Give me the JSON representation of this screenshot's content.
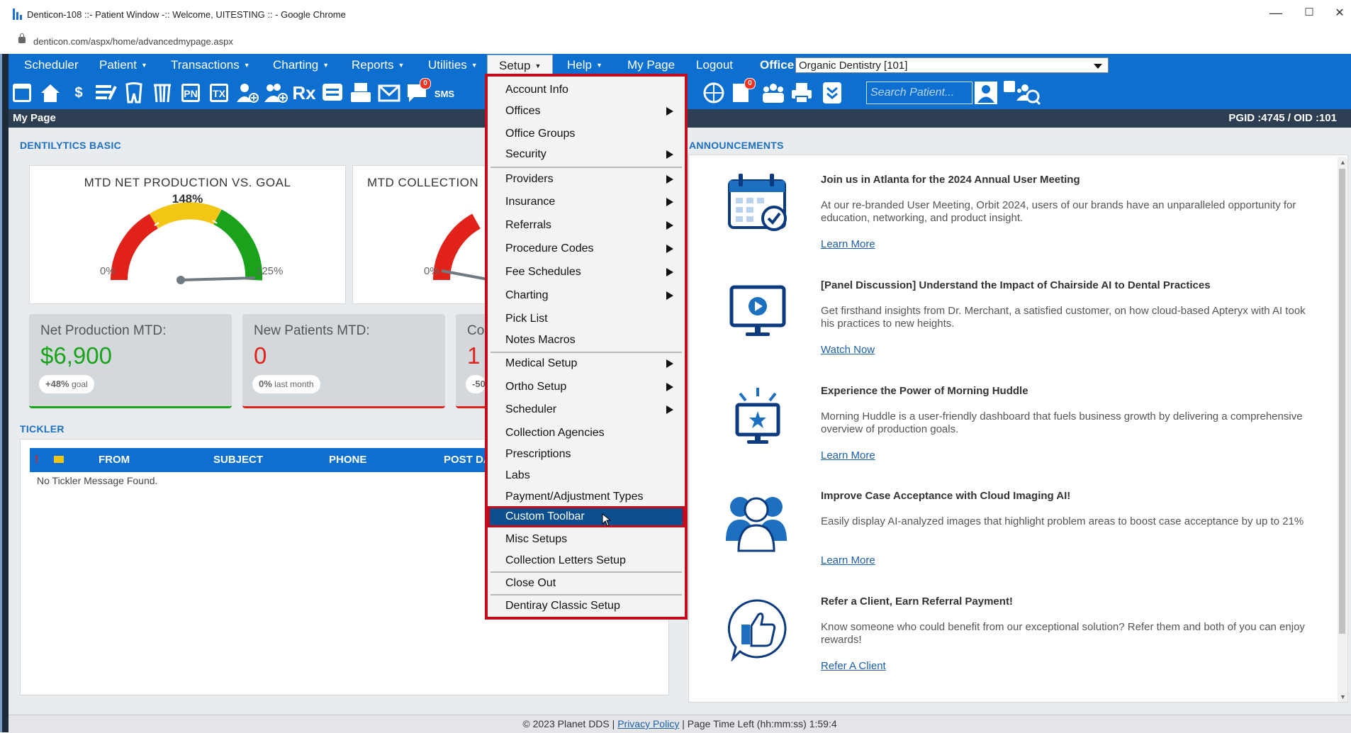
{
  "browser": {
    "title": "Denticon-108 ::- Patient Window -:: Welcome, UITESTING :: - Google Chrome",
    "url": "denticon.com/aspx/home/advancedmypage.aspx",
    "controls": {
      "minimize": "—",
      "maximize": "☐",
      "close": "✕"
    }
  },
  "nav": {
    "items": [
      {
        "label": "Scheduler"
      },
      {
        "label": "Patient",
        "caret": "▼"
      },
      {
        "label": "Transactions",
        "caret": "▼"
      },
      {
        "label": "Charting",
        "caret": "▼"
      },
      {
        "label": "Reports",
        "caret": "▼"
      },
      {
        "label": "Utilities",
        "caret": "▼"
      },
      {
        "label": "Setup",
        "caret": "▼",
        "active": true
      },
      {
        "label": "Help",
        "caret": "▼"
      },
      {
        "label": "My Page"
      },
      {
        "label": "Logout"
      }
    ],
    "office_label": "Office",
    "office_value": "Organic Dentistry [101]"
  },
  "toolbar": {
    "text_icons": {
      "pn": "PN",
      "tx": "TX",
      "rx": "Rx",
      "sms": "SMS"
    },
    "badge": "0",
    "search_placeholder": "Search Patient..."
  },
  "section": {
    "title": "My Page",
    "ids": "PGID :4745  /  OID :101"
  },
  "dentilytics": {
    "heading": "DENTILYTICS BASIC",
    "gauge1": {
      "title": "MTD NET PRODUCTION VS. GOAL",
      "percent": "148%",
      "min": "0%",
      "max": "125%"
    },
    "gauge2": {
      "title": "MTD COLLECTION",
      "min": "0%"
    },
    "stats": [
      {
        "label": "Net Production MTD:",
        "value": "$6,900",
        "pill_value": "+48%",
        "pill_text": "goal",
        "color": "#1aa31a"
      },
      {
        "label": "New Patients MTD:",
        "value": "0",
        "pill_value": "0%",
        "pill_text": "last month",
        "color": "#e0221b"
      },
      {
        "label": "Co",
        "value": "1",
        "pill_value": "-50",
        "pill_text": "",
        "color": "#e0221b"
      }
    ]
  },
  "tickler": {
    "heading": "TICKLER",
    "columns": [
      "FROM",
      "SUBJECT",
      "PHONE",
      "POST DA"
    ],
    "empty": "No Tickler Message Found."
  },
  "announcements": {
    "heading": "ANNOUNCEMENTS",
    "items": [
      {
        "icon": "calendar-icon",
        "title": "Join us in Atlanta for the 2024 Annual User Meeting",
        "body": "At our re-branded User Meeting, Orbit 2024, users of our brands have an unparalleled opportunity for education, networking, and product insight.",
        "link": "Learn More"
      },
      {
        "icon": "video-monitor-icon",
        "title": "[Panel Discussion] Understand the Impact of Chairside AI to Dental Practices",
        "body": "Get firsthand insights from Dr. Merchant, a satisfied customer, on how cloud-based Apteryx with AI took his practices to new heights.",
        "link": "Watch Now"
      },
      {
        "icon": "star-monitor-icon",
        "title": "Experience the Power of Morning Huddle",
        "body": "Morning Huddle is a user-friendly dashboard that fuels business growth by delivering a comprehensive overview of production goals.",
        "link": "Learn More"
      },
      {
        "icon": "people-icon",
        "title": "Improve Case Acceptance with Cloud Imaging AI!",
        "body": "Easily display AI-analyzed images that highlight problem areas to boost case acceptance by up to 21%",
        "link": "Learn More"
      },
      {
        "icon": "thumbs-up-icon",
        "title": "Refer a Client, Earn Referral Payment!",
        "body": "Know someone who could benefit from our exceptional solution? Refer them and both of you can enjoy rewards!",
        "link": "Refer A Client"
      }
    ]
  },
  "setup_menu": {
    "items": [
      {
        "label": "Account Info",
        "sub": false
      },
      {
        "label": "Offices",
        "sub": true
      },
      {
        "label": "Office Groups",
        "sub": false
      },
      {
        "label": "Security",
        "sub": true
      },
      {
        "label": "Providers",
        "sub": true
      },
      {
        "label": "Insurance",
        "sub": true
      },
      {
        "label": "Referrals",
        "sub": true
      },
      {
        "label": "Procedure Codes",
        "sub": true
      },
      {
        "label": "Fee Schedules",
        "sub": true
      },
      {
        "label": "Charting",
        "sub": true
      },
      {
        "label": "Pick List",
        "sub": false
      },
      {
        "label": "Notes Macros",
        "sub": false
      },
      {
        "label": "Medical Setup",
        "sub": true
      },
      {
        "label": "Ortho Setup",
        "sub": true
      },
      {
        "label": "Scheduler",
        "sub": true
      },
      {
        "label": "Collection Agencies",
        "sub": false
      },
      {
        "label": "Prescriptions",
        "sub": false
      },
      {
        "label": "Labs",
        "sub": false
      },
      {
        "label": "Payment/Adjustment Types",
        "sub": false
      },
      {
        "label": "Custom Toolbar",
        "sub": false,
        "highlighted": true
      },
      {
        "label": "Misc Setups",
        "sub": false
      },
      {
        "label": "Collection Letters Setup",
        "sub": false
      },
      {
        "label": "Close Out",
        "sub": false
      },
      {
        "label": "Dentiray Classic Setup",
        "sub": false
      }
    ]
  },
  "footer": {
    "copyright": "© 2023 Planet DDS |",
    "privacy": "Privacy Policy",
    "time": "|  Page Time Left (hh:mm:ss) 1:59:4"
  }
}
